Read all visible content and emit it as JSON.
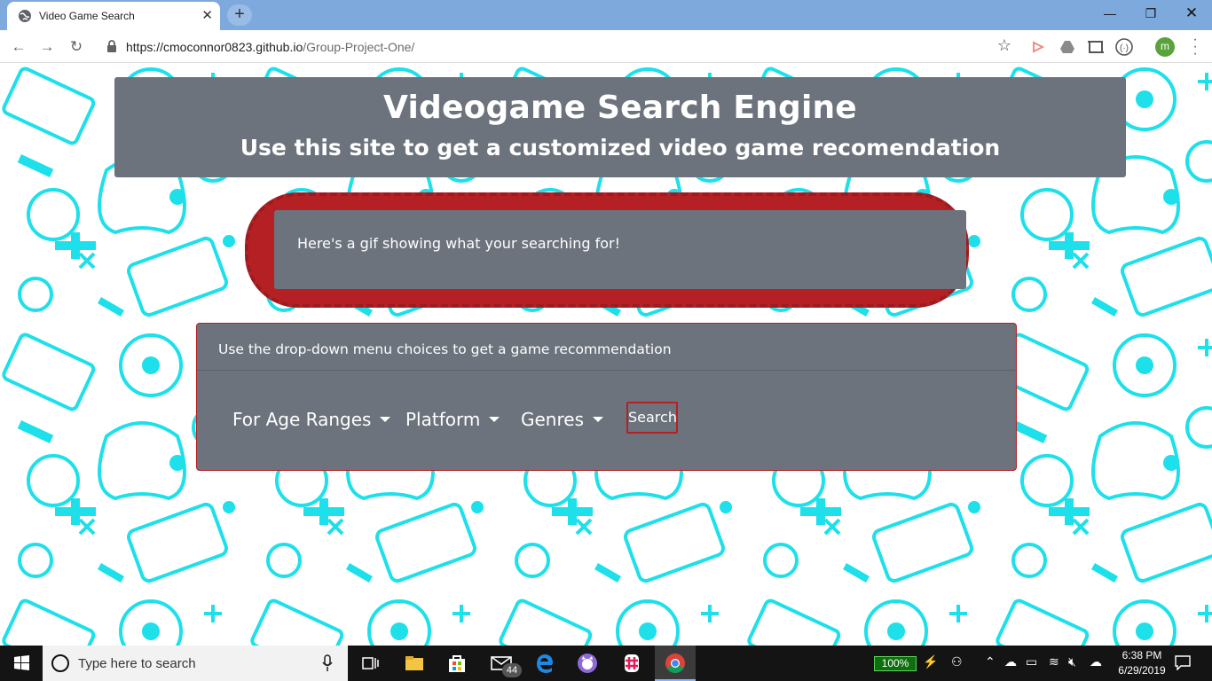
{
  "browser": {
    "tab_title": "Video Game Search",
    "url_host": "https://cmoconnor0823.github.io",
    "url_path": "/Group-Project-One/",
    "profile_initial": "m"
  },
  "page": {
    "title": "Videogame Search Engine",
    "subtitle": "Use this site to get a customized video game recomendation",
    "gif_text": "Here's a gif showing what your searching for!",
    "card_header": "Use the drop-down menu choices to get a game recommendation",
    "dropdowns": [
      {
        "label": "For Age Ranges"
      },
      {
        "label": "Platform"
      },
      {
        "label": "Genres"
      }
    ],
    "search_button": "Search",
    "colors": {
      "panel": "#6c737c",
      "accent_red": "#b52025",
      "pattern": "#1de0ea"
    }
  },
  "taskbar": {
    "search_placeholder": "Type here to search",
    "mail_badge": "44",
    "battery": "100%",
    "time": "6:38 PM",
    "date": "6/29/2019"
  }
}
